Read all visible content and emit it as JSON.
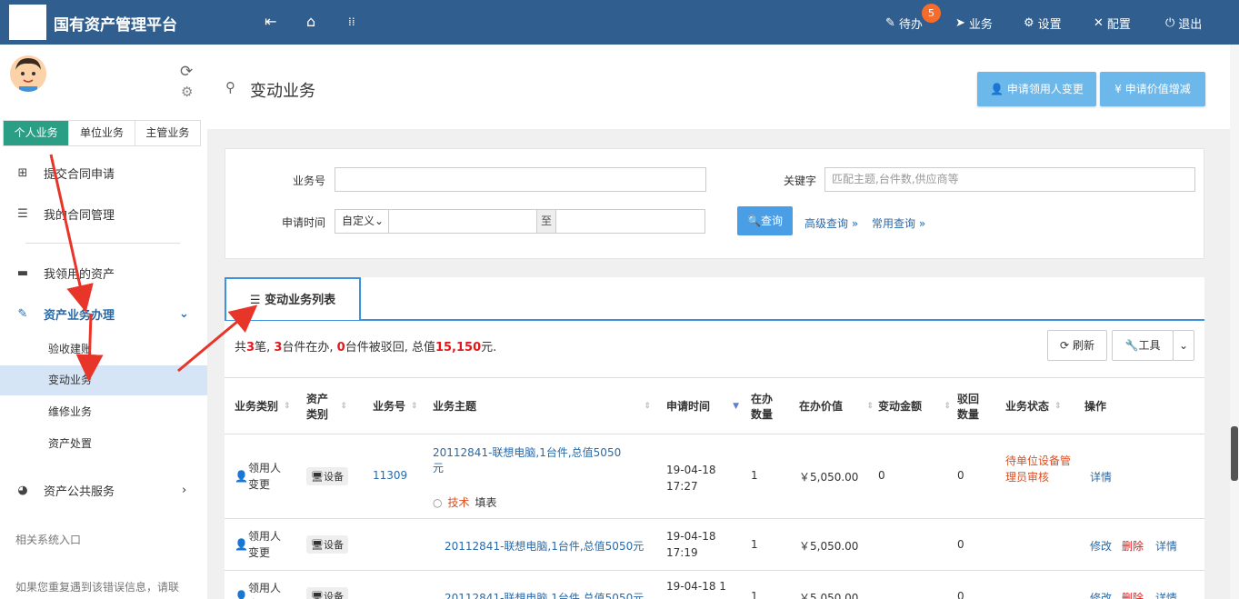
{
  "header": {
    "title": "国有资产管理平台",
    "todo_label": "待办",
    "todo_count": "5",
    "business_label": "业务",
    "settings_label": "设置",
    "config_label": "配置",
    "logout_label": "退出"
  },
  "sidebar": {
    "tabs": [
      "个人业务",
      "单位业务",
      "主管业务"
    ],
    "items": [
      {
        "label": "提交合同申请"
      },
      {
        "label": "我的合同管理"
      },
      {
        "label": "我领用的资产"
      },
      {
        "label": "资产业务办理"
      },
      {
        "label": "资产公共服务"
      }
    ],
    "sub_items": [
      "验收建账",
      "变动业务",
      "维修业务",
      "资产处置"
    ],
    "related": "相关系统入口",
    "hint": "如果您重复遇到该错误信息，请联"
  },
  "page": {
    "title": "变动业务",
    "btn_apply_user": "申请领用人变更",
    "btn_apply_value": "申请价值增减"
  },
  "search": {
    "biz_no_label": "业务号",
    "keyword_label": "关键字",
    "keyword_placeholder": "匹配主题,台件数,供应商等",
    "time_label": "申请时间",
    "time_mode": "自定义",
    "to_label": "至",
    "query_btn": "查询",
    "advanced": "高级查询",
    "common": "常用查询"
  },
  "list": {
    "tab_label": "变动业务列表",
    "summary": {
      "p1": "共",
      "count": "3",
      "p2": "笔, ",
      "inprog": "3",
      "p3": "台件在办, ",
      "rejected": "0",
      "p4": "台件被驳回, 总值",
      "total": "15,150",
      "p5": "元."
    },
    "refresh": "刷新",
    "tools": "工具",
    "columns": [
      "业务类别",
      "资产类别",
      "业务号",
      "业务主题",
      "申请时间",
      "在办数量",
      "在办价值",
      "变动金额",
      "驳回数量",
      "业务状态",
      "操作"
    ],
    "rows": [
      {
        "type": "领用人变更",
        "asset": "设备",
        "no": "11309",
        "subject": "20112841-联想电脑,1台件,总值5050元",
        "sub_tag": "技术",
        "sub_action": "填表",
        "time": "19-04-18 17:27",
        "qty": "1",
        "value": "￥5,050.00",
        "change": "0",
        "reject": "0",
        "status": "待单位设备管理员审核",
        "ops": [
          "详情"
        ]
      },
      {
        "type": "领用人变更",
        "asset": "设备",
        "no": "",
        "subject": "20112841-联想电脑,1台件,总值5050元",
        "time": "19-04-18 17:19",
        "qty": "1",
        "value": "￥5,050.00",
        "change": "",
        "reject": "0",
        "status": "",
        "ops": [
          "修改",
          "删除",
          "详情"
        ]
      },
      {
        "type": "领用人变更",
        "asset": "设备",
        "no": "",
        "subject": "20112841-联想电脑,1台件,总值5050元",
        "time": "19-04-18 1",
        "qty": "1",
        "value": "￥5,050.00",
        "change": "",
        "reject": "0",
        "status": "",
        "ops": [
          "修改",
          "删除",
          "详情"
        ]
      }
    ]
  }
}
